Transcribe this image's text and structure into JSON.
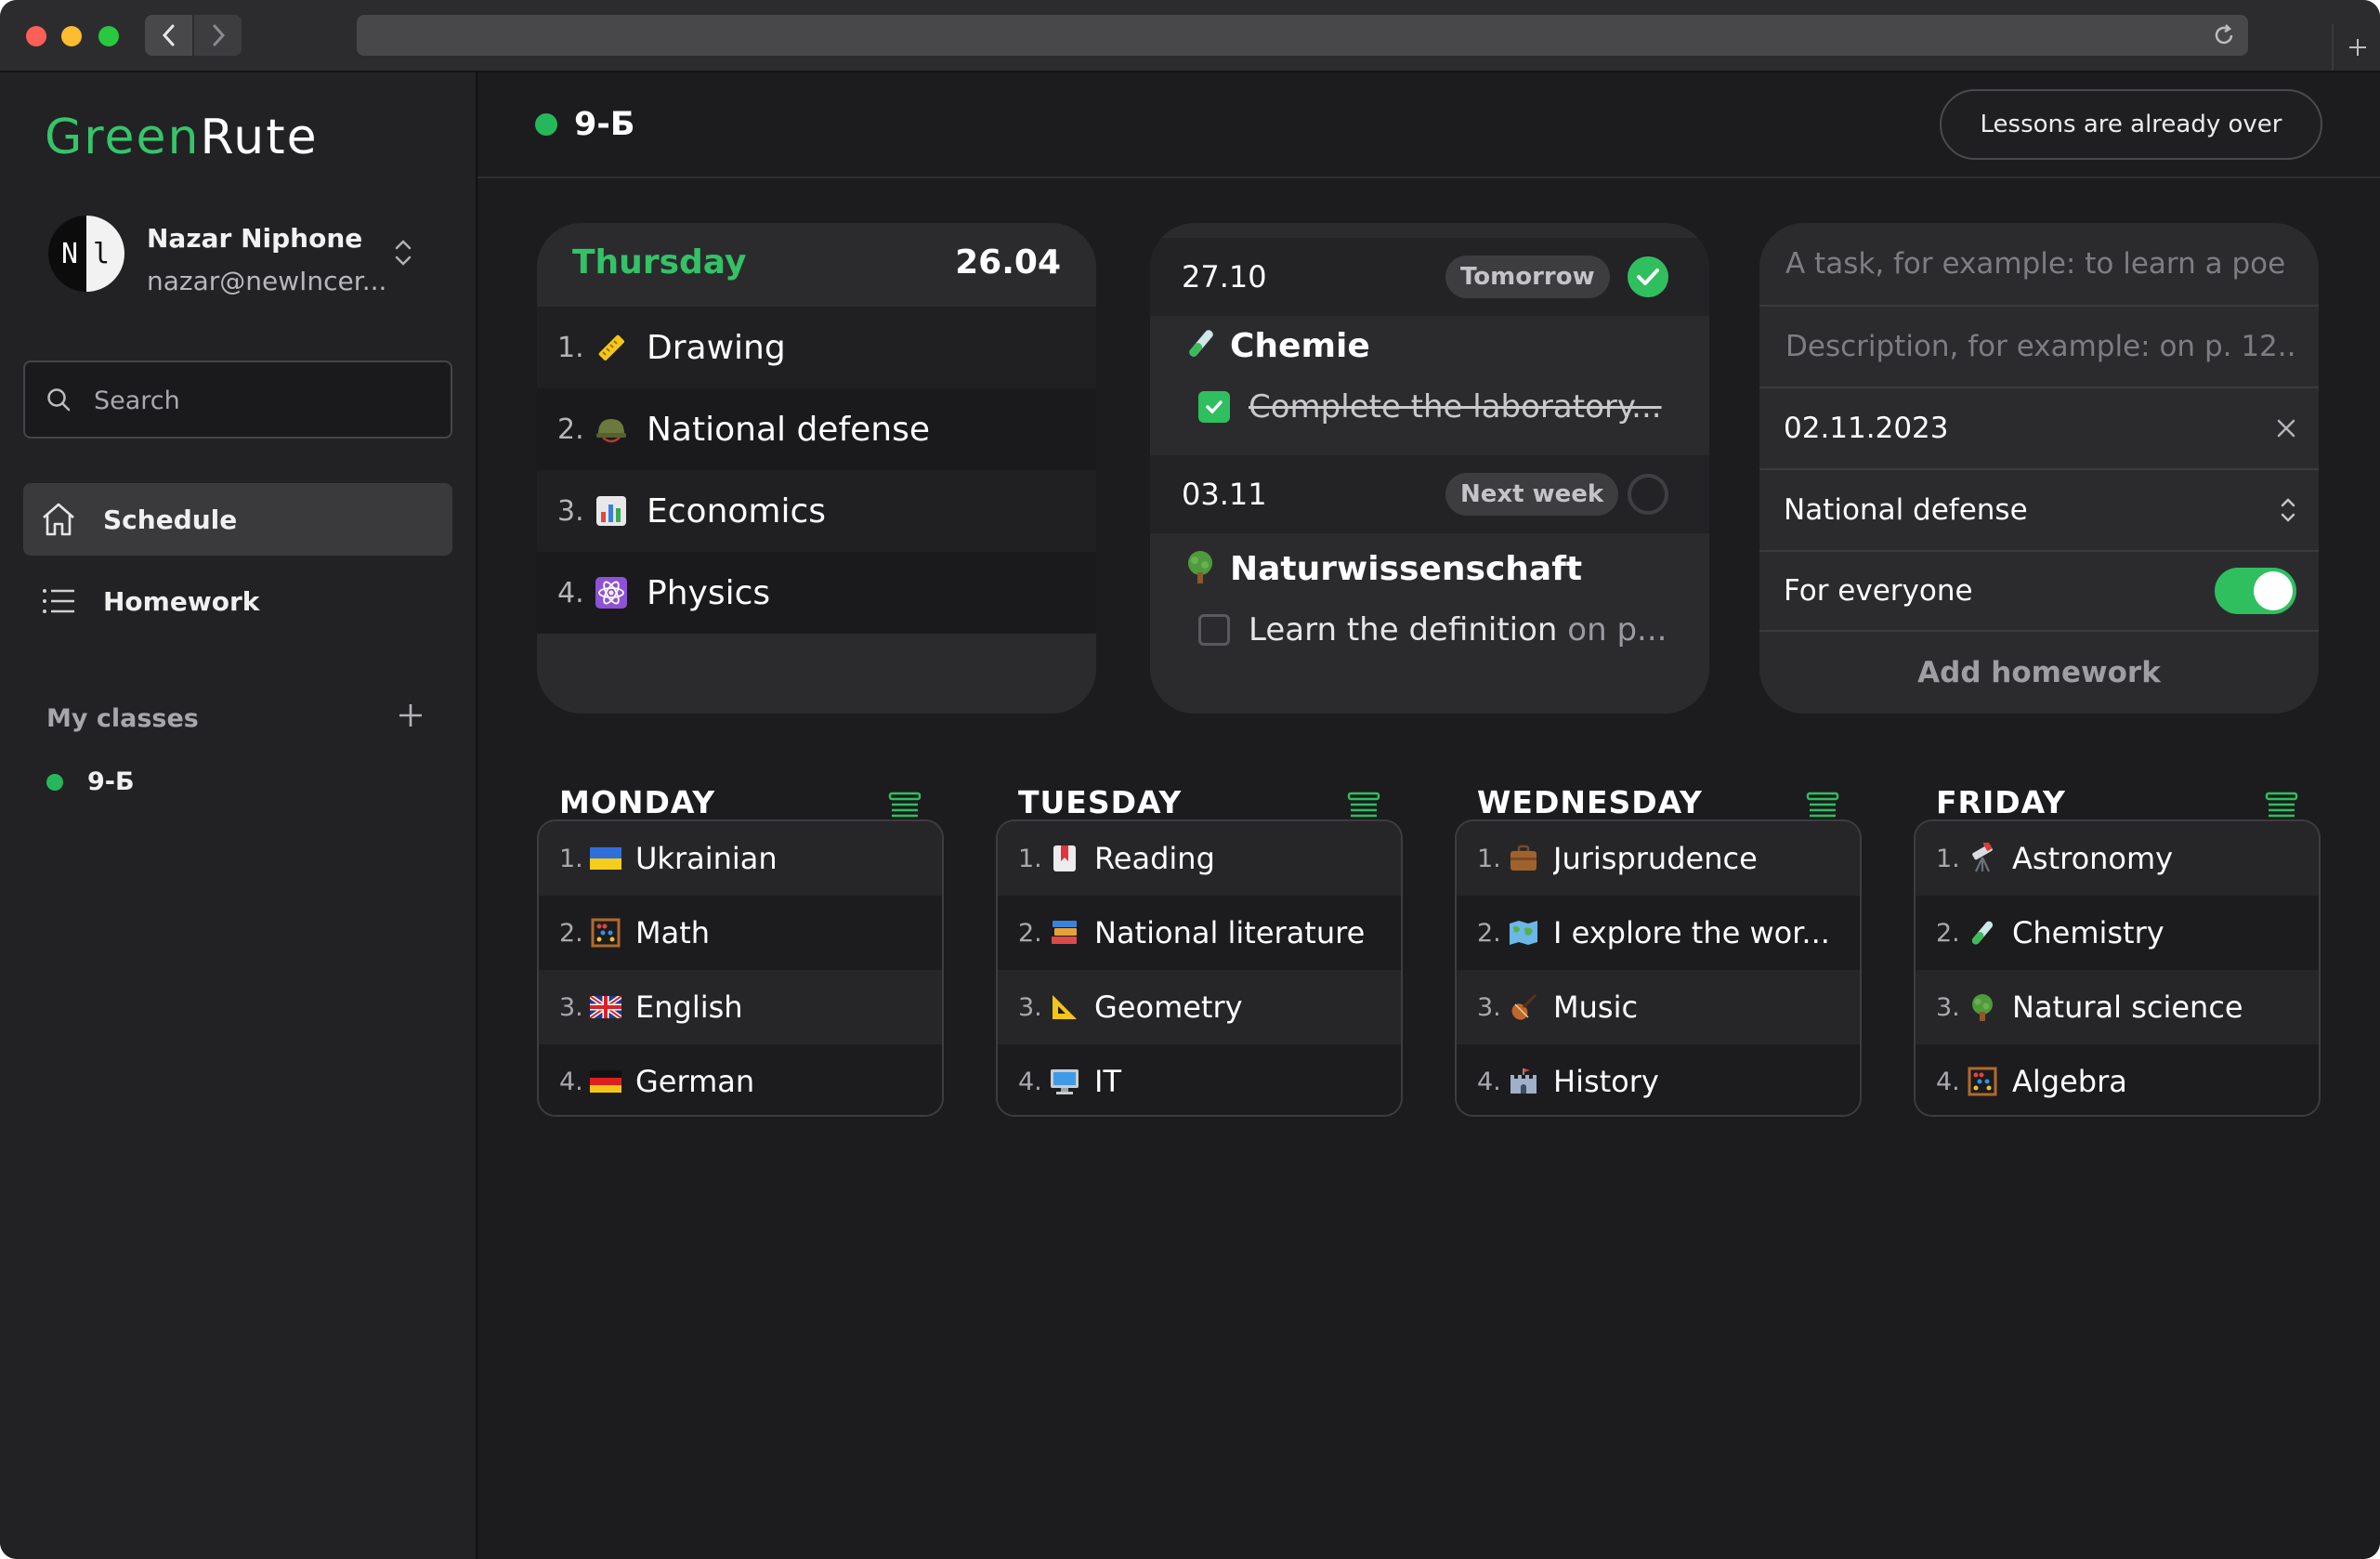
{
  "app": {
    "logo_part1": "Green",
    "logo_part2": "Rute"
  },
  "user": {
    "avatar_left": "N",
    "avatar_right": "l",
    "name": "Nazar Niphone",
    "email": "nazar@newIncer..."
  },
  "search": {
    "placeholder": "Search"
  },
  "nav": {
    "schedule": "Schedule",
    "homework": "Homework"
  },
  "my_classes": {
    "title": "My classes",
    "items": [
      {
        "label": "9-Б",
        "color": "#25b85b"
      }
    ]
  },
  "header": {
    "class_name": "9-Б",
    "status_button": "Lessons are already over"
  },
  "today": {
    "day": "Thursday",
    "date": "26.04",
    "lessons": [
      {
        "num": "1.",
        "icon": "ruler-icon",
        "name": "Drawing"
      },
      {
        "num": "2.",
        "icon": "military-helmet-icon",
        "name": "National defense"
      },
      {
        "num": "3.",
        "icon": "bar-chart-icon",
        "name": "Economics"
      },
      {
        "num": "4.",
        "icon": "atom-icon",
        "name": "Physics"
      }
    ]
  },
  "homework_card": {
    "groups": [
      {
        "date": "27.10",
        "badge": "Tomorrow",
        "done": true,
        "subject_icon": "test-tube-icon",
        "subject": "Chemie",
        "task": "Complete the laboratory...",
        "task_done": true
      },
      {
        "date": "03.11",
        "badge": "Next week",
        "done": false,
        "subject_icon": "tree-icon",
        "subject": "Naturwissenschaft",
        "task": "Learn the definition",
        "task_suffix": " on p...",
        "task_done": false
      }
    ]
  },
  "form": {
    "task_placeholder": "A task, for example: to learn a poe",
    "description_placeholder": "Description, for example: on p. 12..",
    "date_value": "02.11.2023",
    "subject_value": "National defense",
    "for_everyone_label": "For everyone",
    "for_everyone_on": true,
    "add_button": "Add homework"
  },
  "week": [
    {
      "day": "MONDAY",
      "lessons": [
        {
          "num": "1.",
          "icon": "ukraine-flag-icon",
          "name": "Ukrainian"
        },
        {
          "num": "2.",
          "icon": "abacus-icon",
          "name": "Math"
        },
        {
          "num": "3.",
          "icon": "uk-flag-icon",
          "name": "English"
        },
        {
          "num": "4.",
          "icon": "germany-flag-icon",
          "name": "German"
        }
      ]
    },
    {
      "day": "TUESDAY",
      "lessons": [
        {
          "num": "1.",
          "icon": "bookmark-icon",
          "name": "Reading"
        },
        {
          "num": "2.",
          "icon": "books-icon",
          "name": "National literature"
        },
        {
          "num": "3.",
          "icon": "triangular-ruler-icon",
          "name": "Geometry"
        },
        {
          "num": "4.",
          "icon": "computer-icon",
          "name": "IT"
        }
      ]
    },
    {
      "day": "WEDNESDAY",
      "lessons": [
        {
          "num": "1.",
          "icon": "briefcase-icon",
          "name": "Jurisprudence"
        },
        {
          "num": "2.",
          "icon": "world-map-icon",
          "name": "I explore the wor..."
        },
        {
          "num": "3.",
          "icon": "violin-icon",
          "name": "Music"
        },
        {
          "num": "4.",
          "icon": "castle-icon",
          "name": "History"
        }
      ]
    },
    {
      "day": "FRIDAY",
      "lessons": [
        {
          "num": "1.",
          "icon": "telescope-icon",
          "name": "Astronomy"
        },
        {
          "num": "2.",
          "icon": "test-tube-icon",
          "name": "Chemistry"
        },
        {
          "num": "3.",
          "icon": "tree-icon",
          "name": "Natural science"
        },
        {
          "num": "4.",
          "icon": "abacus-icon",
          "name": "Algebra"
        }
      ]
    }
  ],
  "colors": {
    "accent": "#2fbf5f",
    "background": "#1c1c1e",
    "sidebar": "#222224"
  }
}
